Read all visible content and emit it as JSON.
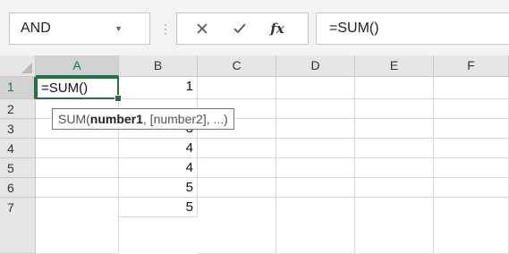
{
  "namebox": {
    "value": "AND",
    "caret_icon": "caret-down-icon"
  },
  "formula_bar": {
    "more_icon": "kebab-icon",
    "cancel_icon": "x-icon",
    "enter_icon": "check-icon",
    "fx_label": "fx",
    "formula": "=SUM()"
  },
  "columns": [
    "A",
    "B",
    "C",
    "D",
    "E",
    "F"
  ],
  "rows": [
    "1",
    "2",
    "3",
    "4",
    "5",
    "6",
    "7"
  ],
  "cells": {
    "A1": "=SUM()",
    "B": [
      "1",
      "",
      "3",
      "4",
      "4",
      "5",
      "5"
    ]
  },
  "tooltip": {
    "prefix": "SUM(",
    "bold_arg": "number1",
    "rest": ", [number2], ...)"
  },
  "colors": {
    "accent": "#217346",
    "header_bg": "#e6e6e6",
    "toolbar_bg": "#f3f3f3"
  }
}
